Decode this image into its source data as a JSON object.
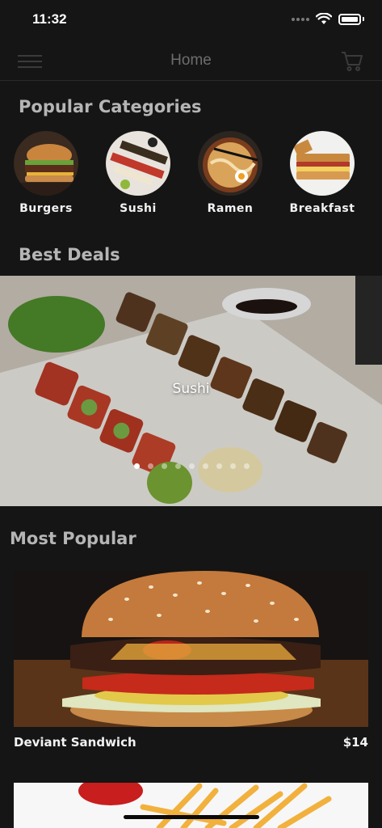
{
  "status_bar": {
    "time": "11:32"
  },
  "nav": {
    "title": "Home"
  },
  "sections": {
    "categories_title": "Popular Categories",
    "deals_title": "Best Deals",
    "popular_title": "Most Popular"
  },
  "categories": [
    {
      "label": "Burgers"
    },
    {
      "label": "Sushi"
    },
    {
      "label": "Ramen"
    },
    {
      "label": "Breakfast"
    }
  ],
  "deals": {
    "caption": "Sushi",
    "page_count": 9,
    "active_page": 1
  },
  "popular_items": [
    {
      "name": "Deviant Sandwich",
      "price": "$14"
    }
  ],
  "colors": {
    "background": "#151515",
    "section_title": "#b5b5b5",
    "nav_title": "#6d6d6d"
  }
}
